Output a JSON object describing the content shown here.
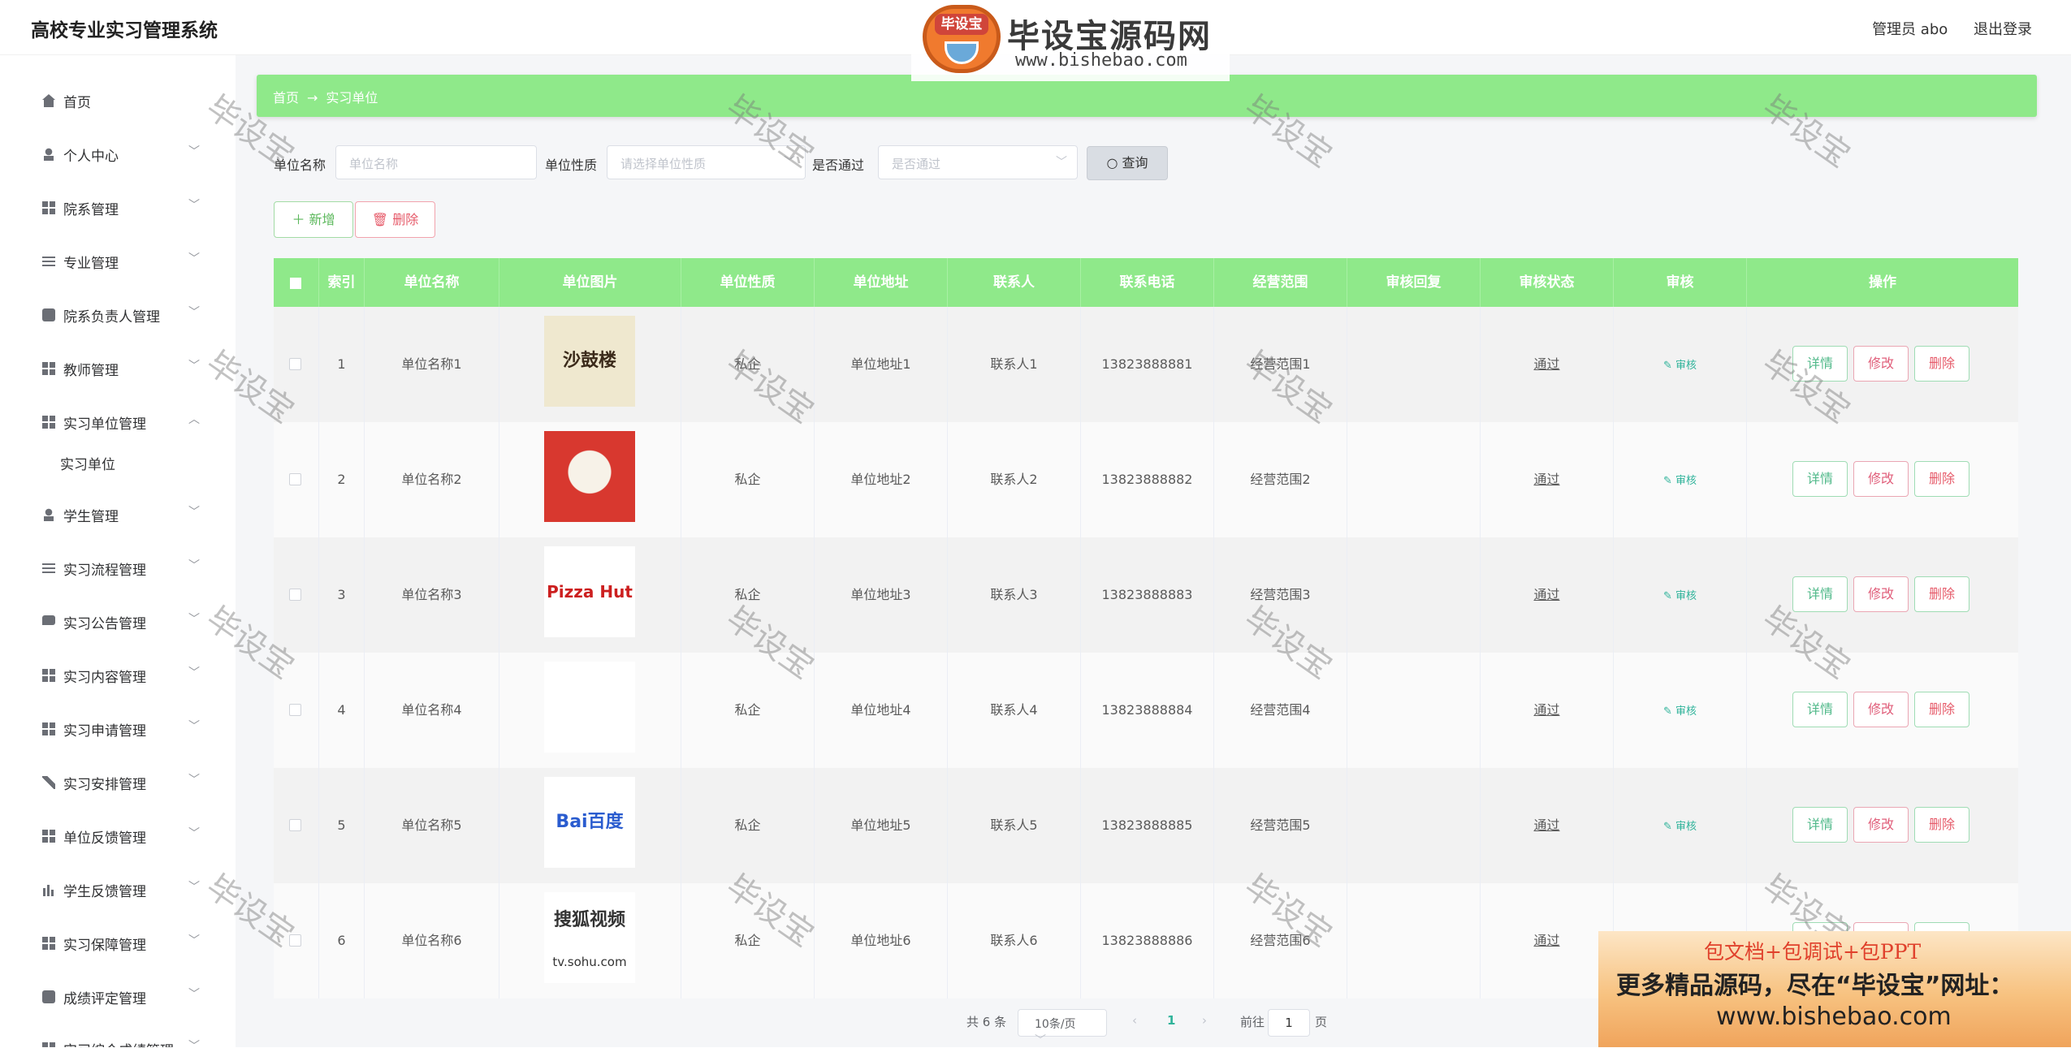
{
  "header": {
    "title": "高校专业实习管理系统",
    "admin_label": "管理员 abo",
    "logout_label": "退出登录"
  },
  "logo_watermark": {
    "badge_text": "毕设宝",
    "title": "毕设宝源码网",
    "url": "www.bishebao.com"
  },
  "sidebar": {
    "items": [
      {
        "label": "首页",
        "icon": "home-icon"
      },
      {
        "label": "个人中心",
        "icon": "user-icon"
      },
      {
        "label": "院系管理",
        "icon": "grid-icon"
      },
      {
        "label": "专业管理",
        "icon": "sliders-icon"
      },
      {
        "label": "院系负责人管理",
        "icon": "box-icon"
      },
      {
        "label": "教师管理",
        "icon": "grid-icon"
      },
      {
        "label": "实习单位管理",
        "icon": "grid-icon"
      },
      {
        "label": "学生管理",
        "icon": "user-icon"
      },
      {
        "label": "实习流程管理",
        "icon": "list-icon"
      },
      {
        "label": "实习公告管理",
        "icon": "message-icon"
      },
      {
        "label": "实习内容管理",
        "icon": "grid-icon"
      },
      {
        "label": "实习申请管理",
        "icon": "grid-icon"
      },
      {
        "label": "实习安排管理",
        "icon": "send-icon"
      },
      {
        "label": "单位反馈管理",
        "icon": "grid-icon"
      },
      {
        "label": "学生反馈管理",
        "icon": "chart-icon"
      },
      {
        "label": "实习保障管理",
        "icon": "grid-icon"
      },
      {
        "label": "成绩评定管理",
        "icon": "clipboard-icon"
      },
      {
        "label": "实习综合成绩管理",
        "icon": "grid-icon"
      }
    ],
    "sub_item": "实习单位"
  },
  "breadcrumb": {
    "home": "首页",
    "arrow": "→",
    "current": "实习单位"
  },
  "search": {
    "name_label": "单位名称",
    "name_placeholder": "单位名称",
    "type_label": "单位性质",
    "type_placeholder": "请选择单位性质",
    "pass_label": "是否通过",
    "pass_placeholder": "是否通过",
    "query_label": "查询"
  },
  "actions": {
    "add_label": "新增",
    "delete_label": "删除"
  },
  "table": {
    "headers": [
      "索引",
      "单位名称",
      "单位图片",
      "单位性质",
      "单位地址",
      "联系人",
      "联系电话",
      "经营范围",
      "审核回复",
      "审核状态",
      "审核",
      "操作"
    ],
    "rows": [
      {
        "index": "1",
        "name": "单位名称1",
        "image": "沙鼓楼",
        "type": "私企",
        "address": "单位地址1",
        "contact": "联系人1",
        "phone": "13823888881",
        "scope": "经营范围1",
        "reply": "",
        "status": "通过",
        "audit": "审核"
      },
      {
        "index": "2",
        "name": "单位名称2",
        "image": "",
        "type": "私企",
        "address": "单位地址2",
        "contact": "联系人2",
        "phone": "13823888882",
        "scope": "经营范围2",
        "reply": "",
        "status": "通过",
        "audit": "审核"
      },
      {
        "index": "3",
        "name": "单位名称3",
        "image": "Pizza Hut",
        "type": "私企",
        "address": "单位地址3",
        "contact": "联系人3",
        "phone": "13823888883",
        "scope": "经营范围3",
        "reply": "",
        "status": "通过",
        "audit": "审核"
      },
      {
        "index": "4",
        "name": "单位名称4",
        "image": "",
        "type": "私企",
        "address": "单位地址4",
        "contact": "联系人4",
        "phone": "13823888884",
        "scope": "经营范围4",
        "reply": "",
        "status": "通过",
        "audit": "审核"
      },
      {
        "index": "5",
        "name": "单位名称5",
        "image": "Bai百度",
        "type": "私企",
        "address": "单位地址5",
        "contact": "联系人5",
        "phone": "13823888885",
        "scope": "经营范围5",
        "reply": "",
        "status": "通过",
        "audit": "审核"
      },
      {
        "index": "6",
        "name": "单位名称6",
        "image": "搜狐视频",
        "image_sub": "tv.sohu.com",
        "type": "私企",
        "address": "单位地址6",
        "contact": "联系人6",
        "phone": "13823888886",
        "scope": "经营范围6",
        "reply": "",
        "status": "通过",
        "audit": "审核"
      }
    ],
    "ops": {
      "detail": "详情",
      "edit": "修改",
      "delete": "删除"
    }
  },
  "pagination": {
    "total": "共 6 条",
    "page_size": "10条/页",
    "current_page": "1",
    "goto_prefix": "前往",
    "goto_value": "1",
    "goto_suffix": "页"
  },
  "watermark_text": "毕设宝",
  "promo": {
    "line1": "包文档+包调试+包PPT",
    "line2": "更多精品源码，尽在“毕设宝”网址：",
    "line3": "www.bishebao.com"
  },
  "colors": {
    "accent_green": "#8fe98a",
    "link_teal": "#2fb39a",
    "danger": "#e65b6a"
  }
}
